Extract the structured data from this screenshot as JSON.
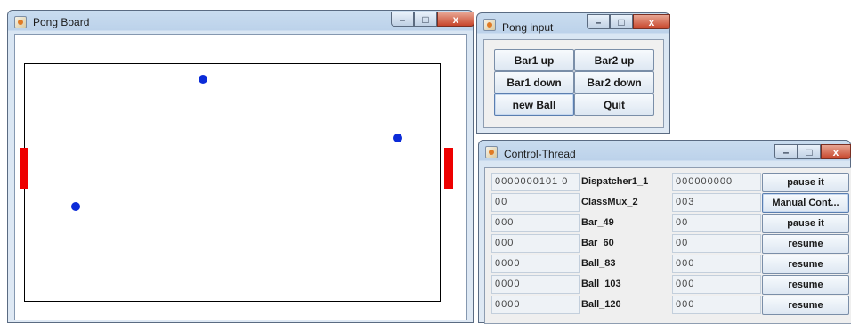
{
  "pong_board": {
    "title": "Pong Board",
    "paddles": [
      {
        "name": "left-paddle",
        "color": "#ee0000"
      },
      {
        "name": "right-paddle",
        "color": "#ee0000"
      }
    ],
    "balls_color": "#0b2bd8"
  },
  "pong_input": {
    "title": "Pong input",
    "buttons": [
      "Bar1 up",
      "Bar2 up",
      "Bar1 down",
      "Bar2 down",
      "new Ball",
      "Quit"
    ]
  },
  "control_thread": {
    "title": "Control-Thread",
    "rows": [
      {
        "counter": "0000000101 0",
        "name": "Dispatcher1_1",
        "queue": "000000000",
        "action": "pause it"
      },
      {
        "counter": "00",
        "name": "ClassMux_2",
        "queue": "003",
        "action": "Manual Cont..."
      },
      {
        "counter": "000",
        "name": "Bar_49",
        "queue": "00",
        "action": "pause it"
      },
      {
        "counter": "000",
        "name": "Bar_60",
        "queue": "00",
        "action": "resume"
      },
      {
        "counter": "0000",
        "name": "Ball_83",
        "queue": "000",
        "action": "resume"
      },
      {
        "counter": "0000",
        "name": "Ball_103",
        "queue": "000",
        "action": "resume"
      },
      {
        "counter": "0000",
        "name": "Ball_120",
        "queue": "000",
        "action": "resume"
      }
    ]
  },
  "window_controls": {
    "minimize": "–",
    "maximize": "□",
    "close": "x"
  }
}
